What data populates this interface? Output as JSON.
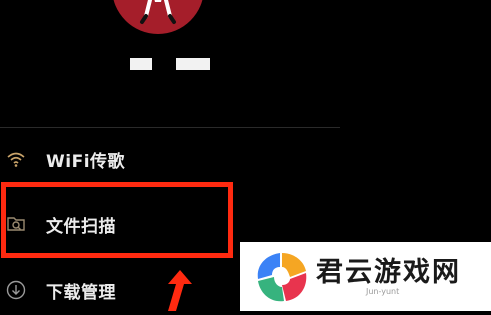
{
  "menu": {
    "items": [
      {
        "label": "WiFi传歌",
        "icon": "wifi-icon"
      },
      {
        "label": "文件扫描",
        "icon": "scan-icon"
      },
      {
        "label": "下载管理",
        "icon": "download-icon"
      }
    ]
  },
  "colors": {
    "background": "#000000",
    "highlight": "#ff2a10",
    "avatar": "#a51e2a"
  },
  "watermark": {
    "title": "君云游戏网",
    "subtitle": "Jun-yunt"
  }
}
